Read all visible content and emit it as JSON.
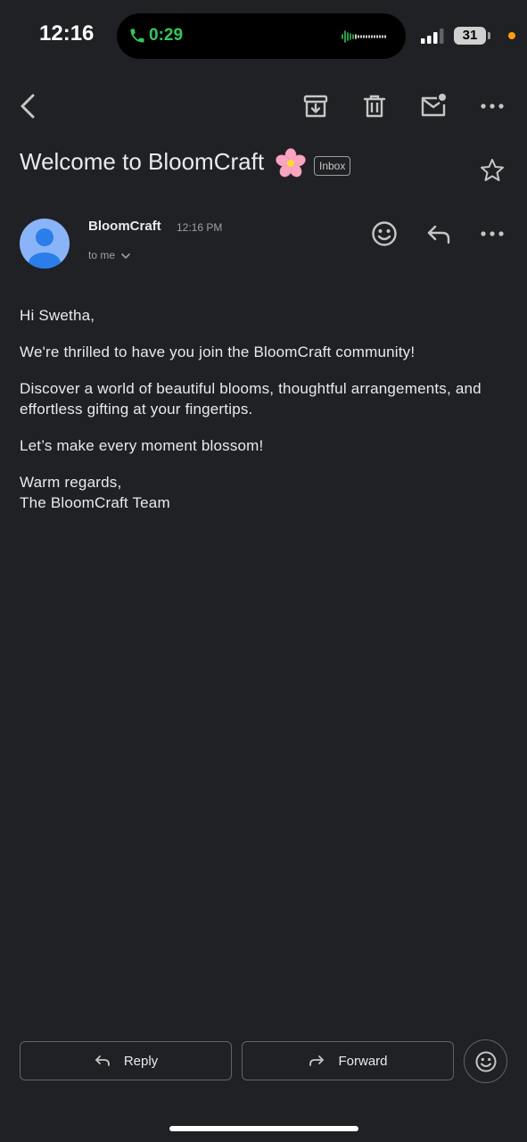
{
  "status_bar": {
    "time": "12:16",
    "call_timer": "0:29",
    "battery_level": "31",
    "call_color": "#34c759",
    "privacy_dot_color": "#ff9f0a"
  },
  "toolbar": {
    "icons": [
      "back-icon",
      "archive-icon",
      "delete-icon",
      "mark-unread-icon",
      "more-icon"
    ]
  },
  "email": {
    "subject": "Welcome to BloomCraft",
    "subject_emoji": "cherry-blossom",
    "label": "Inbox",
    "sender": "BloomCraft",
    "time": "12:16 PM",
    "recipient": "to me",
    "body": {
      "greeting": "Hi Swetha,",
      "paragraph1": "We're thrilled to have you join the BloomCraft community!",
      "paragraph2": "Discover a world of beautiful blooms, thoughtful arrangements, and effortless gifting at your fingertips.",
      "paragraph3": "Let’s make every moment blossom!",
      "closing": "Warm regards,",
      "signature": "The BloomCraft Team"
    }
  },
  "actions": {
    "reply_label": "Reply",
    "forward_label": "Forward"
  },
  "colors": {
    "background": "#202124",
    "text": "#e8eaed",
    "avatar": "#8ab4f8"
  }
}
